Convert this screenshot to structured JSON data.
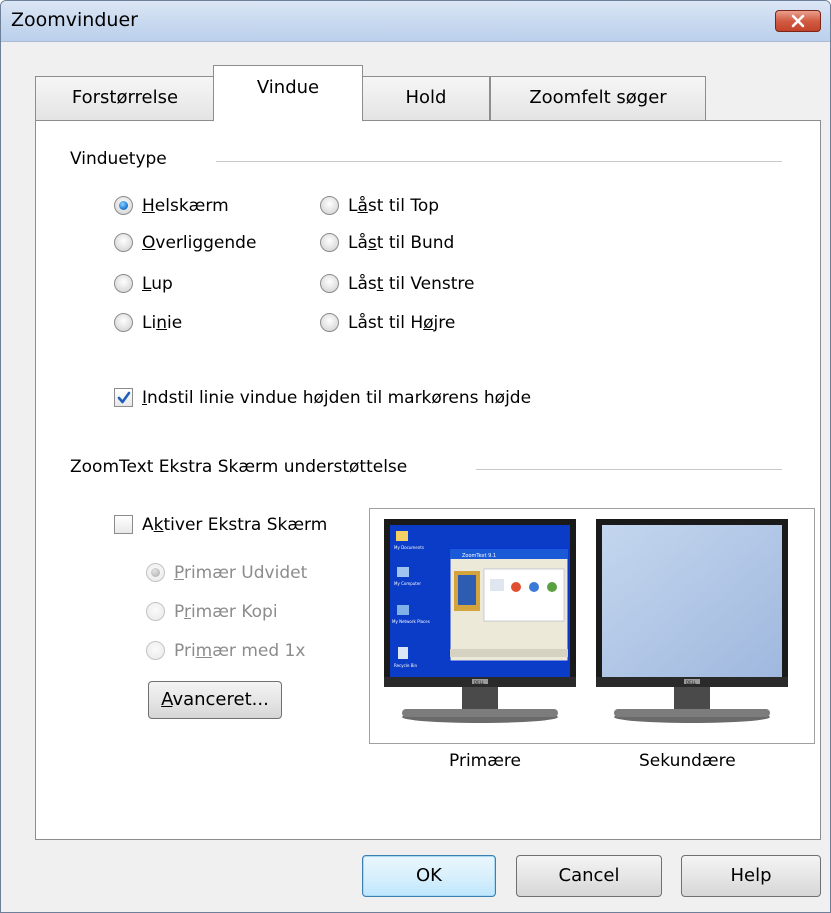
{
  "window": {
    "title": "Zoomvinduer"
  },
  "tabs": [
    {
      "label": "Forstørrelse"
    },
    {
      "label": "Vindue"
    },
    {
      "label": "Hold"
    },
    {
      "label": "Zoomfelt søger"
    }
  ],
  "window_type": {
    "group_label": "Vinduetype",
    "options": [
      {
        "pre": "",
        "key": "H",
        "post": "elskærm",
        "checked": true
      },
      {
        "pre": "",
        "key": "O",
        "post": "verliggende",
        "checked": false
      },
      {
        "pre": "",
        "key": "L",
        "post": "up",
        "checked": false
      },
      {
        "pre": "Li",
        "key": "n",
        "post": "ie",
        "checked": false
      },
      {
        "pre": "L",
        "key": "å",
        "post": "st til Top",
        "checked": false
      },
      {
        "pre": "Lå",
        "key": "s",
        "post": "t til Bund",
        "checked": false
      },
      {
        "pre": "Lås",
        "key": "t",
        "post": " til Venstre",
        "checked": false
      },
      {
        "pre": "Låst til H",
        "key": "ø",
        "post": "jre",
        "checked": false
      }
    ],
    "line_height_checkbox": {
      "pre": "",
      "key": "I",
      "post": "ndstil linie vindue højden til markørens højde",
      "checked": true
    }
  },
  "extra_screen": {
    "group_label": "ZoomText Ekstra Skærm understøttelse",
    "enable_checkbox": {
      "pre": "A",
      "key": "k",
      "post": "tiver Ekstra Skærm",
      "checked": false
    },
    "options": [
      {
        "pre": "",
        "key": "P",
        "post": "rimær Udvidet",
        "checked": true
      },
      {
        "pre": "P",
        "key": "r",
        "post": "imær Kopi",
        "checked": false
      },
      {
        "pre": "Pri",
        "key": "m",
        "post": "ær med 1x",
        "checked": false
      }
    ],
    "advanced_button": {
      "pre": "",
      "key": "A",
      "post": "vanceret..."
    },
    "primary_caption": "Primære",
    "secondary_caption": "Sekundære",
    "monitor_brand": "DELL",
    "desktop_icons": [
      "My Documents",
      "My Computer",
      "My Network Places",
      "Recycle Bin"
    ],
    "zoomtext_window_title": "ZoomText 9.1"
  },
  "buttons": {
    "ok": "OK",
    "cancel": "Cancel",
    "help": "Help"
  },
  "colors": {
    "desktop_blue": "#0a3cc8",
    "selected_radio": "#1f7fd8",
    "title_bar": "#c9daf0",
    "close_red": "#c2432a"
  }
}
